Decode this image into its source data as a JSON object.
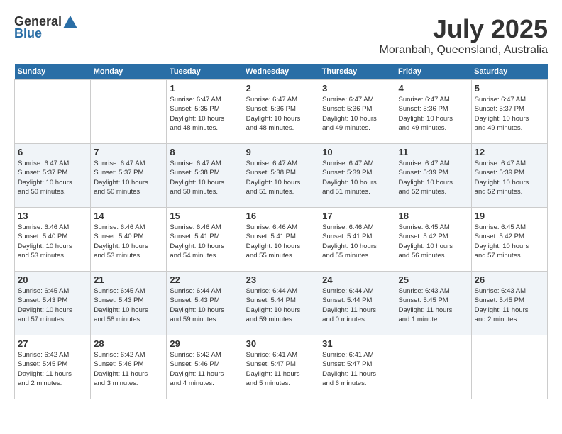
{
  "header": {
    "logo_general": "General",
    "logo_blue": "Blue",
    "month_year": "July 2025",
    "location": "Moranbah, Queensland, Australia"
  },
  "weekdays": [
    "Sunday",
    "Monday",
    "Tuesday",
    "Wednesday",
    "Thursday",
    "Friday",
    "Saturday"
  ],
  "weeks": [
    [
      {
        "day": "",
        "info": ""
      },
      {
        "day": "",
        "info": ""
      },
      {
        "day": "1",
        "info": "Sunrise: 6:47 AM\nSunset: 5:35 PM\nDaylight: 10 hours\nand 48 minutes."
      },
      {
        "day": "2",
        "info": "Sunrise: 6:47 AM\nSunset: 5:36 PM\nDaylight: 10 hours\nand 48 minutes."
      },
      {
        "day": "3",
        "info": "Sunrise: 6:47 AM\nSunset: 5:36 PM\nDaylight: 10 hours\nand 49 minutes."
      },
      {
        "day": "4",
        "info": "Sunrise: 6:47 AM\nSunset: 5:36 PM\nDaylight: 10 hours\nand 49 minutes."
      },
      {
        "day": "5",
        "info": "Sunrise: 6:47 AM\nSunset: 5:37 PM\nDaylight: 10 hours\nand 49 minutes."
      }
    ],
    [
      {
        "day": "6",
        "info": "Sunrise: 6:47 AM\nSunset: 5:37 PM\nDaylight: 10 hours\nand 50 minutes."
      },
      {
        "day": "7",
        "info": "Sunrise: 6:47 AM\nSunset: 5:37 PM\nDaylight: 10 hours\nand 50 minutes."
      },
      {
        "day": "8",
        "info": "Sunrise: 6:47 AM\nSunset: 5:38 PM\nDaylight: 10 hours\nand 50 minutes."
      },
      {
        "day": "9",
        "info": "Sunrise: 6:47 AM\nSunset: 5:38 PM\nDaylight: 10 hours\nand 51 minutes."
      },
      {
        "day": "10",
        "info": "Sunrise: 6:47 AM\nSunset: 5:39 PM\nDaylight: 10 hours\nand 51 minutes."
      },
      {
        "day": "11",
        "info": "Sunrise: 6:47 AM\nSunset: 5:39 PM\nDaylight: 10 hours\nand 52 minutes."
      },
      {
        "day": "12",
        "info": "Sunrise: 6:47 AM\nSunset: 5:39 PM\nDaylight: 10 hours\nand 52 minutes."
      }
    ],
    [
      {
        "day": "13",
        "info": "Sunrise: 6:46 AM\nSunset: 5:40 PM\nDaylight: 10 hours\nand 53 minutes."
      },
      {
        "day": "14",
        "info": "Sunrise: 6:46 AM\nSunset: 5:40 PM\nDaylight: 10 hours\nand 53 minutes."
      },
      {
        "day": "15",
        "info": "Sunrise: 6:46 AM\nSunset: 5:41 PM\nDaylight: 10 hours\nand 54 minutes."
      },
      {
        "day": "16",
        "info": "Sunrise: 6:46 AM\nSunset: 5:41 PM\nDaylight: 10 hours\nand 55 minutes."
      },
      {
        "day": "17",
        "info": "Sunrise: 6:46 AM\nSunset: 5:41 PM\nDaylight: 10 hours\nand 55 minutes."
      },
      {
        "day": "18",
        "info": "Sunrise: 6:45 AM\nSunset: 5:42 PM\nDaylight: 10 hours\nand 56 minutes."
      },
      {
        "day": "19",
        "info": "Sunrise: 6:45 AM\nSunset: 5:42 PM\nDaylight: 10 hours\nand 57 minutes."
      }
    ],
    [
      {
        "day": "20",
        "info": "Sunrise: 6:45 AM\nSunset: 5:43 PM\nDaylight: 10 hours\nand 57 minutes."
      },
      {
        "day": "21",
        "info": "Sunrise: 6:45 AM\nSunset: 5:43 PM\nDaylight: 10 hours\nand 58 minutes."
      },
      {
        "day": "22",
        "info": "Sunrise: 6:44 AM\nSunset: 5:43 PM\nDaylight: 10 hours\nand 59 minutes."
      },
      {
        "day": "23",
        "info": "Sunrise: 6:44 AM\nSunset: 5:44 PM\nDaylight: 10 hours\nand 59 minutes."
      },
      {
        "day": "24",
        "info": "Sunrise: 6:44 AM\nSunset: 5:44 PM\nDaylight: 11 hours\nand 0 minutes."
      },
      {
        "day": "25",
        "info": "Sunrise: 6:43 AM\nSunset: 5:45 PM\nDaylight: 11 hours\nand 1 minute."
      },
      {
        "day": "26",
        "info": "Sunrise: 6:43 AM\nSunset: 5:45 PM\nDaylight: 11 hours\nand 2 minutes."
      }
    ],
    [
      {
        "day": "27",
        "info": "Sunrise: 6:42 AM\nSunset: 5:45 PM\nDaylight: 11 hours\nand 2 minutes."
      },
      {
        "day": "28",
        "info": "Sunrise: 6:42 AM\nSunset: 5:46 PM\nDaylight: 11 hours\nand 3 minutes."
      },
      {
        "day": "29",
        "info": "Sunrise: 6:42 AM\nSunset: 5:46 PM\nDaylight: 11 hours\nand 4 minutes."
      },
      {
        "day": "30",
        "info": "Sunrise: 6:41 AM\nSunset: 5:47 PM\nDaylight: 11 hours\nand 5 minutes."
      },
      {
        "day": "31",
        "info": "Sunrise: 6:41 AM\nSunset: 5:47 PM\nDaylight: 11 hours\nand 6 minutes."
      },
      {
        "day": "",
        "info": ""
      },
      {
        "day": "",
        "info": ""
      }
    ]
  ]
}
